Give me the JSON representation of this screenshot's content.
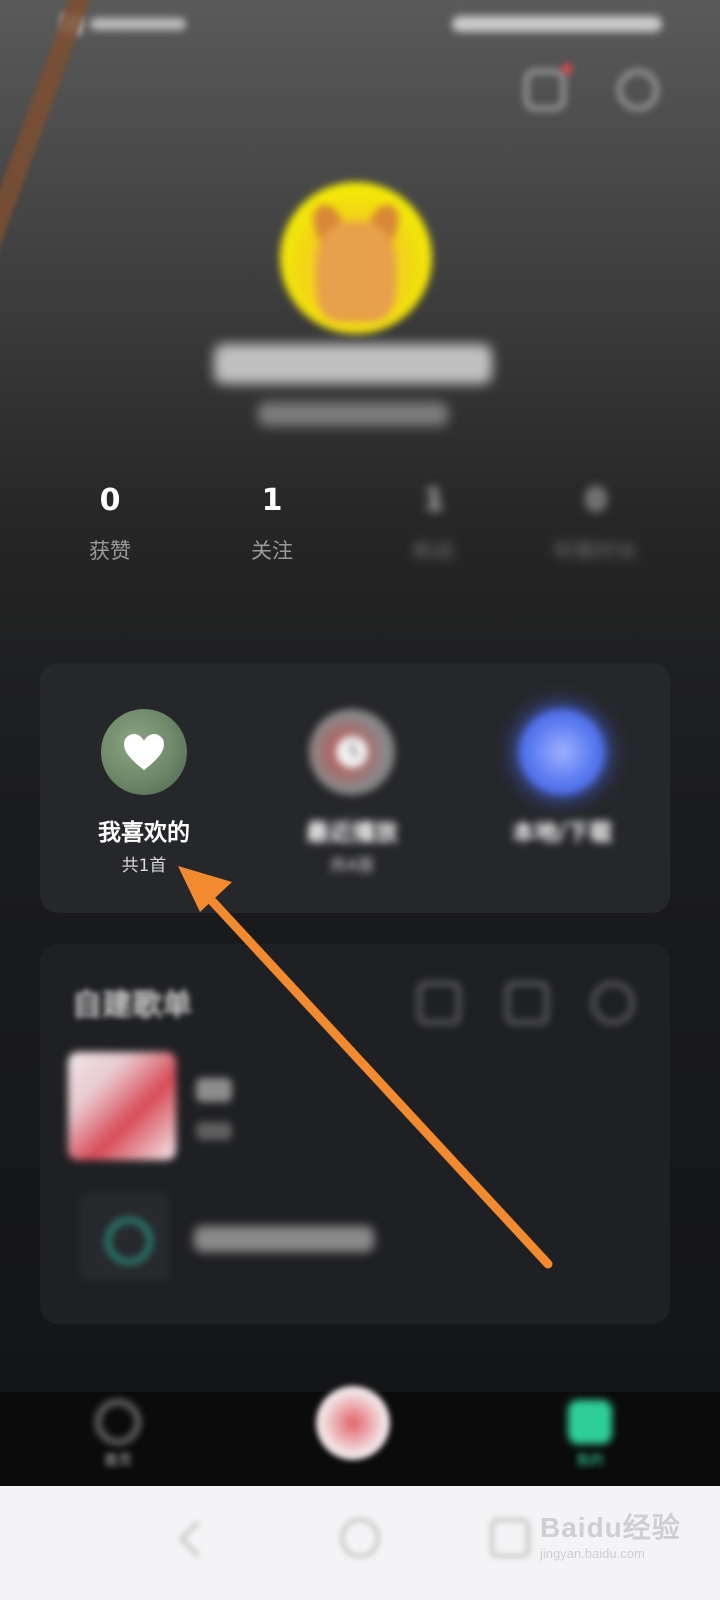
{
  "profile": {
    "stats": [
      {
        "value": "0",
        "label": "获赞"
      },
      {
        "value": "1",
        "label": "关注"
      },
      {
        "value": "1",
        "label": "粉丝"
      },
      {
        "value": "0",
        "label": "听歌时长"
      }
    ]
  },
  "quick_access": [
    {
      "title": "我喜欢的",
      "subtitle": "共1首",
      "icon": "heart-icon"
    },
    {
      "title": "最近播放",
      "subtitle": "共4首",
      "icon": "clock-icon"
    },
    {
      "title": "本地/下载",
      "subtitle": "",
      "icon": "download-icon"
    }
  ],
  "playlists": {
    "title": "自建歌单"
  },
  "bottom_nav": {
    "left_label": "首页",
    "right_label": "我的"
  },
  "watermark": {
    "main": "Baidu经验",
    "sub": "jingyan.baidu.com"
  },
  "colors": {
    "annotation_arrow": "#f28a30",
    "accent_green": "#2fcf9a",
    "local_blue": "#5b7cf0"
  }
}
